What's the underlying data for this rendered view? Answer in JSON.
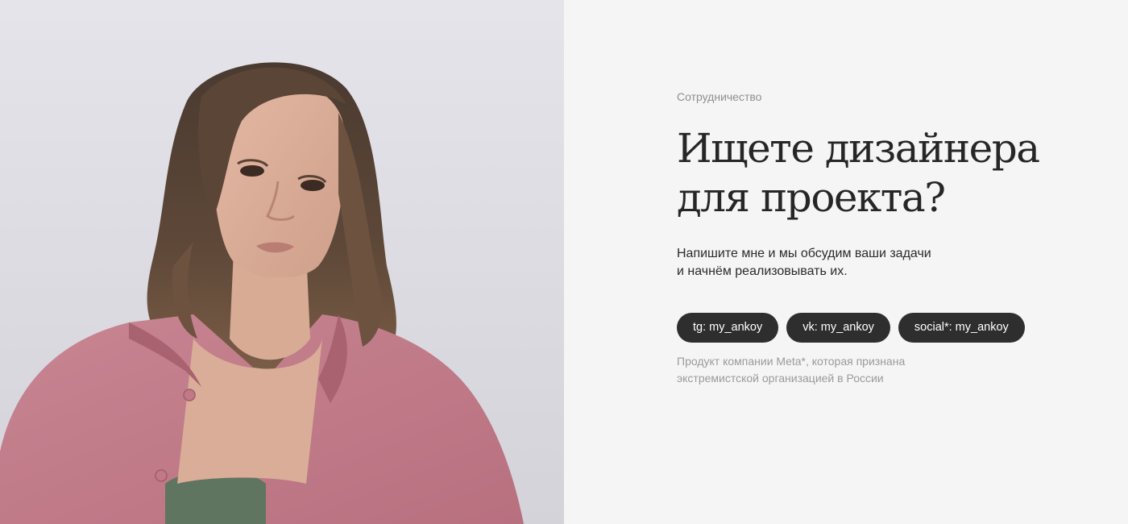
{
  "section": {
    "eyebrow": "Сотрудничество",
    "headline_line1": "Ищете дизайнера",
    "headline_line2": "для проекта?",
    "lead_line1": "Напишите мне и мы обсудим ваши задачи",
    "lead_line2": "и начнём реализовывать их."
  },
  "contacts": [
    {
      "label": "tg: my_ankoy"
    },
    {
      "label": "vk: my_ankoy"
    },
    {
      "label": "social*: my_ankoy"
    }
  ],
  "footnote": {
    "line1": "Продукт компании Meta*, которая признана",
    "line2": "экстремистской организацией в России"
  },
  "colors": {
    "background": "#f5f5f5",
    "chip": "#2e2e2e",
    "chip_text": "#ffffff",
    "headline": "#262626",
    "muted": "#9a9a9a"
  },
  "media": {
    "photo": "portrait-photo"
  }
}
